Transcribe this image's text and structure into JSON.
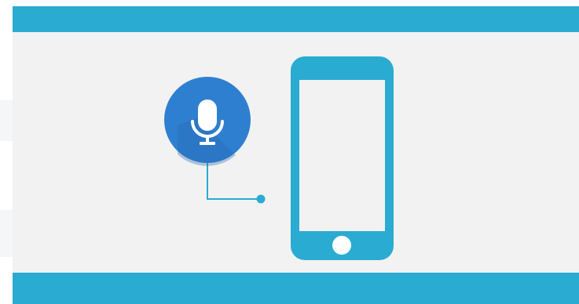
{
  "colors": {
    "accent": "#2aabd2",
    "background": "#f2f2f2",
    "mic_circle": "#2f7fd0",
    "mic_shadow": "#276bb3",
    "white": "#ffffff",
    "page": "#ffffff",
    "edge_stripe": "#f4f6f8"
  },
  "icons": {
    "microphone": "microphone-icon",
    "phone": "smartphone-icon"
  }
}
